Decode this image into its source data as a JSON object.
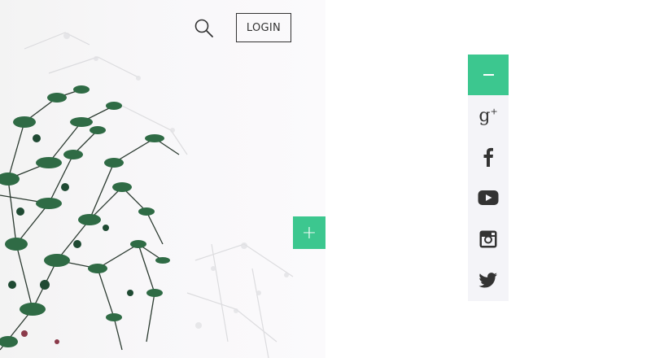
{
  "header": {
    "login_label": "LOGIN",
    "search_icon": "search-icon"
  },
  "hero": {
    "expand_label": "+"
  },
  "social": {
    "items": [
      {
        "name": "google-plus",
        "label": "g+",
        "icon": "google-plus-icon"
      },
      {
        "name": "facebook",
        "icon": "facebook-icon"
      },
      {
        "name": "youtube",
        "icon": "youtube-icon"
      },
      {
        "name": "instagram",
        "icon": "instagram-icon"
      },
      {
        "name": "twitter",
        "icon": "twitter-icon"
      }
    ]
  },
  "colors": {
    "accent": "#3cc78f",
    "icon": "#333333",
    "social_bg": "#f4f4f8"
  }
}
